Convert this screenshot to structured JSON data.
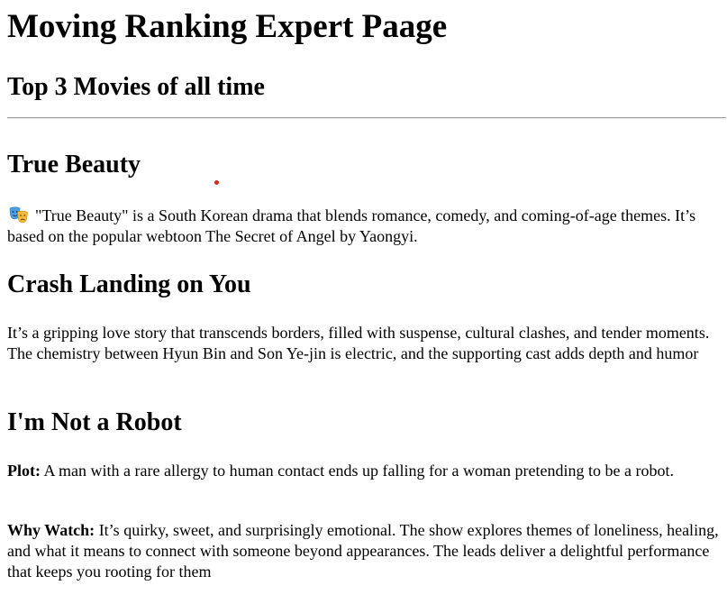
{
  "page": {
    "title": "Moving Ranking Expert Paage",
    "subtitle": "Top 3 Movies of all time"
  },
  "movies": [
    {
      "title": "True Beauty",
      "icon": "performing-arts-masks-icon",
      "description": "\"True Beauty\" is a South Korean drama that blends romance, comedy, and coming-of-age themes. It’s based on the popular webtoon The Secret of Angel by Yaongyi."
    },
    {
      "title": "Crash Landing on You",
      "description": "It’s a gripping love story that transcends borders, filled with suspense, cultural clashes, and tender moments. The chemistry between Hyun Bin and Son Ye-jin is electric, and the supporting cast adds depth and humor"
    },
    {
      "title": "I'm Not a Robot",
      "plot_label": "Plot:",
      "plot": "A man with a rare allergy to human contact ends up falling for a woman pretending to be a robot.",
      "why_label": "Why Watch:",
      "why": "It’s quirky, sweet, and surprisingly emotional. The show explores themes of loneliness, healing, and what it means to connect with someone beyond appearances. The leads deliver a delightful performance that keeps you rooting for them"
    }
  ],
  "colors": {
    "text": "#000000",
    "background": "#ffffff",
    "rule": "#9a9a9a",
    "marker_dot": "#d42a1e"
  }
}
